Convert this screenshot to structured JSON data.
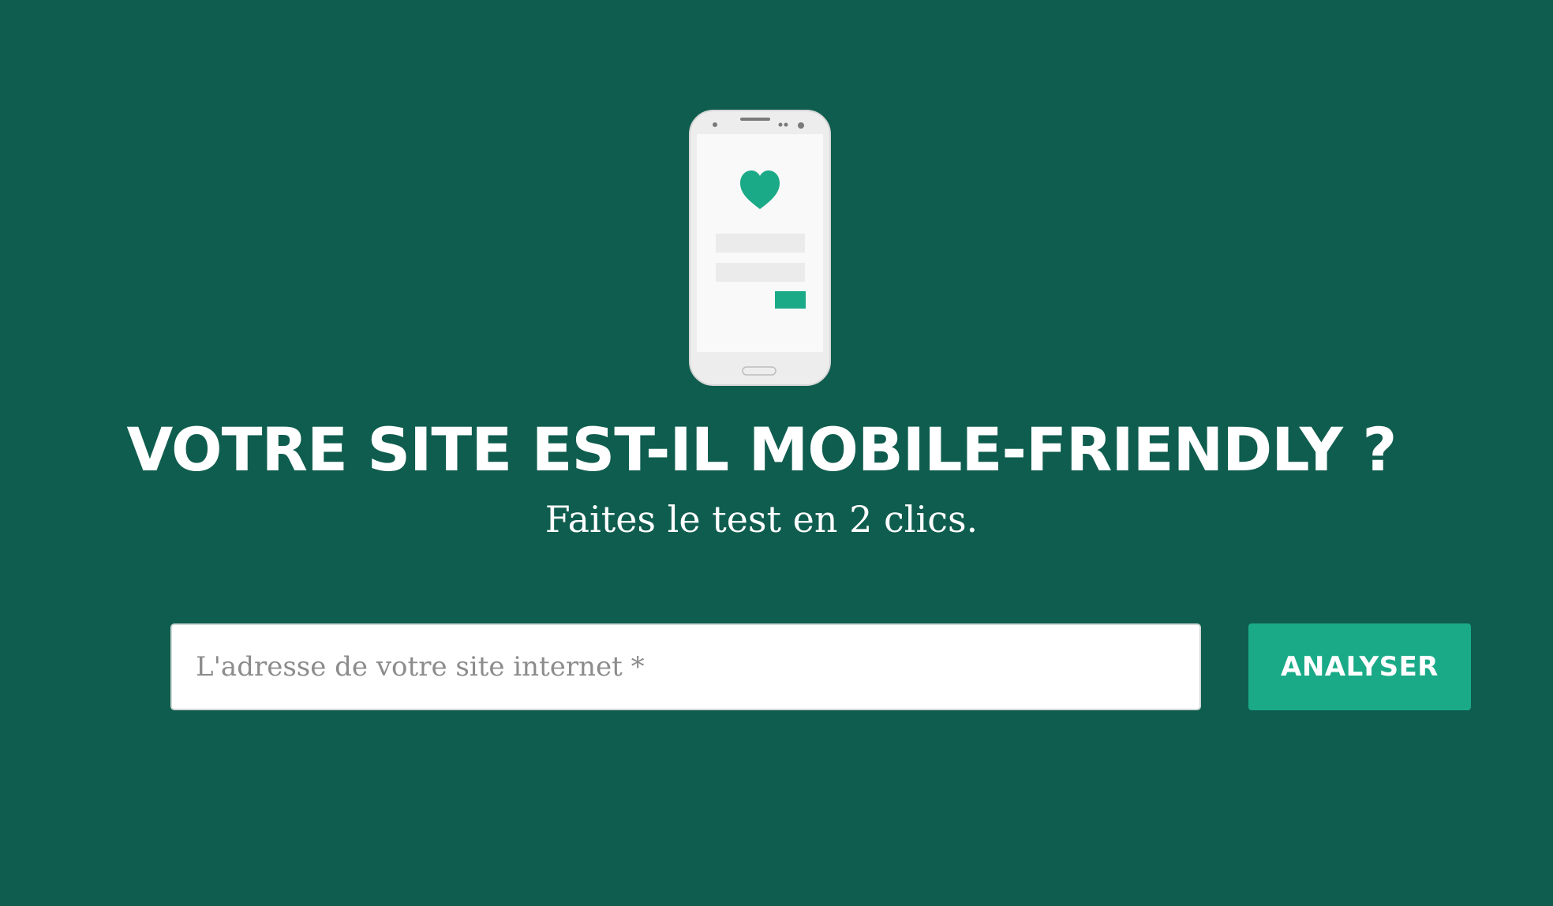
{
  "hero": {
    "illustration": "phone-heart-icon",
    "title": "VOTRE SITE EST-IL MOBILE-FRIENDLY ?",
    "subtitle": "Faites le test en 2 clics.",
    "form": {
      "url_value": "",
      "url_placeholder": "L'adresse de votre site internet *",
      "submit_label": "ANALYSER"
    }
  },
  "colors": {
    "background": "#0f5d4f",
    "accent": "#1aaa88",
    "phone_body": "#ededed",
    "phone_screen": "#f9f9f9"
  }
}
